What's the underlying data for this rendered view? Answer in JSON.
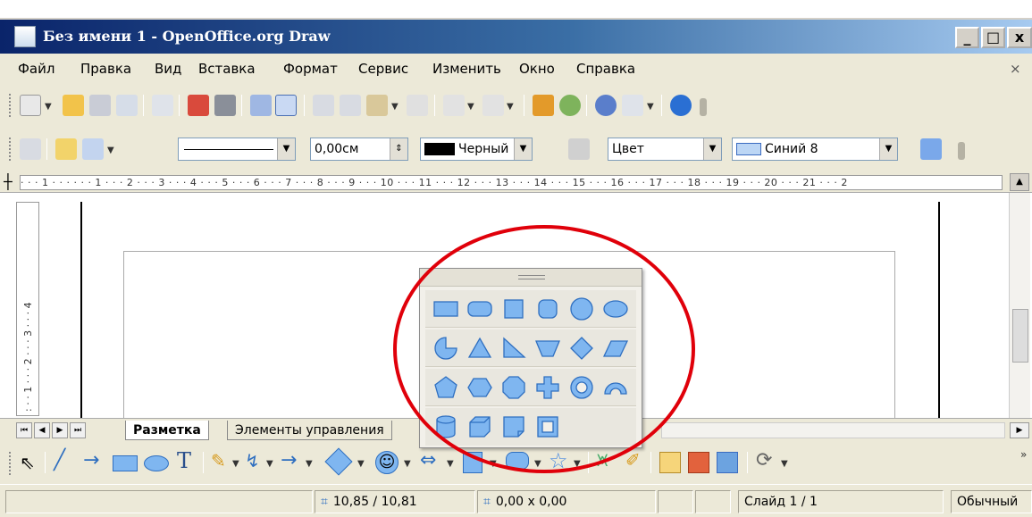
{
  "window": {
    "title": "Без имени 1 - OpenOffice.org Draw",
    "min": "_",
    "max": "□",
    "close": "x"
  },
  "menu": {
    "items": [
      "Файл",
      "Правка",
      "Вид",
      "Вставка",
      "Формат",
      "Сервис",
      "Изменить",
      "Окно",
      "Справка"
    ],
    "close": "×"
  },
  "line_toolbar": {
    "line_width": "0,00см",
    "line_color": "Черный",
    "fill_type": "Цвет",
    "fill_color": "Синий 8"
  },
  "ruler": {
    "h_ticks": "· · · 1 · · ·    · · · 1 · · · 2 · · · 3 · · · 4 · · · 5 · · · 6 · · · 7 · · · 8 · · · 9 · · · 10 · · · 11 · · · 12 · · · 13 · · · 14 · · · 15 · · · 16 · · · 17 · · · 18 · · · 19 · · · 20 · · · 21 · · · 2",
    "v_ticks": ": · · 1 · · · 2 · · · 3 · · · 4"
  },
  "tabs": {
    "active": "Разметка",
    "other": "Элементы управления"
  },
  "status": {
    "position": "10,85 / 10,81",
    "size": "0,00 x 0,00",
    "slide": "Слайд 1 / 1",
    "mode": "Обычный"
  },
  "colors": {
    "accent_blue": "#7fb6f0",
    "highlight_red": "#e0000a",
    "titlebar": "#0a246a"
  },
  "popup": {
    "rows": [
      [
        "rectangle-icon",
        "rounded-rectangle-icon",
        "square-icon",
        "rounded-square-icon",
        "circle-icon",
        "ellipse-icon"
      ],
      [
        "circle-pie-icon",
        "isosceles-triangle-icon",
        "right-triangle-icon",
        "trapezoid-icon",
        "diamond-icon",
        "parallelogram-icon"
      ],
      [
        "regular-pentagon-icon",
        "hexagon-icon",
        "octagon-icon",
        "cross-icon",
        "ring-icon",
        "block-arc-icon"
      ],
      [
        "can-icon",
        "cube-icon",
        "folded-corner-icon",
        "frame-icon"
      ]
    ]
  }
}
